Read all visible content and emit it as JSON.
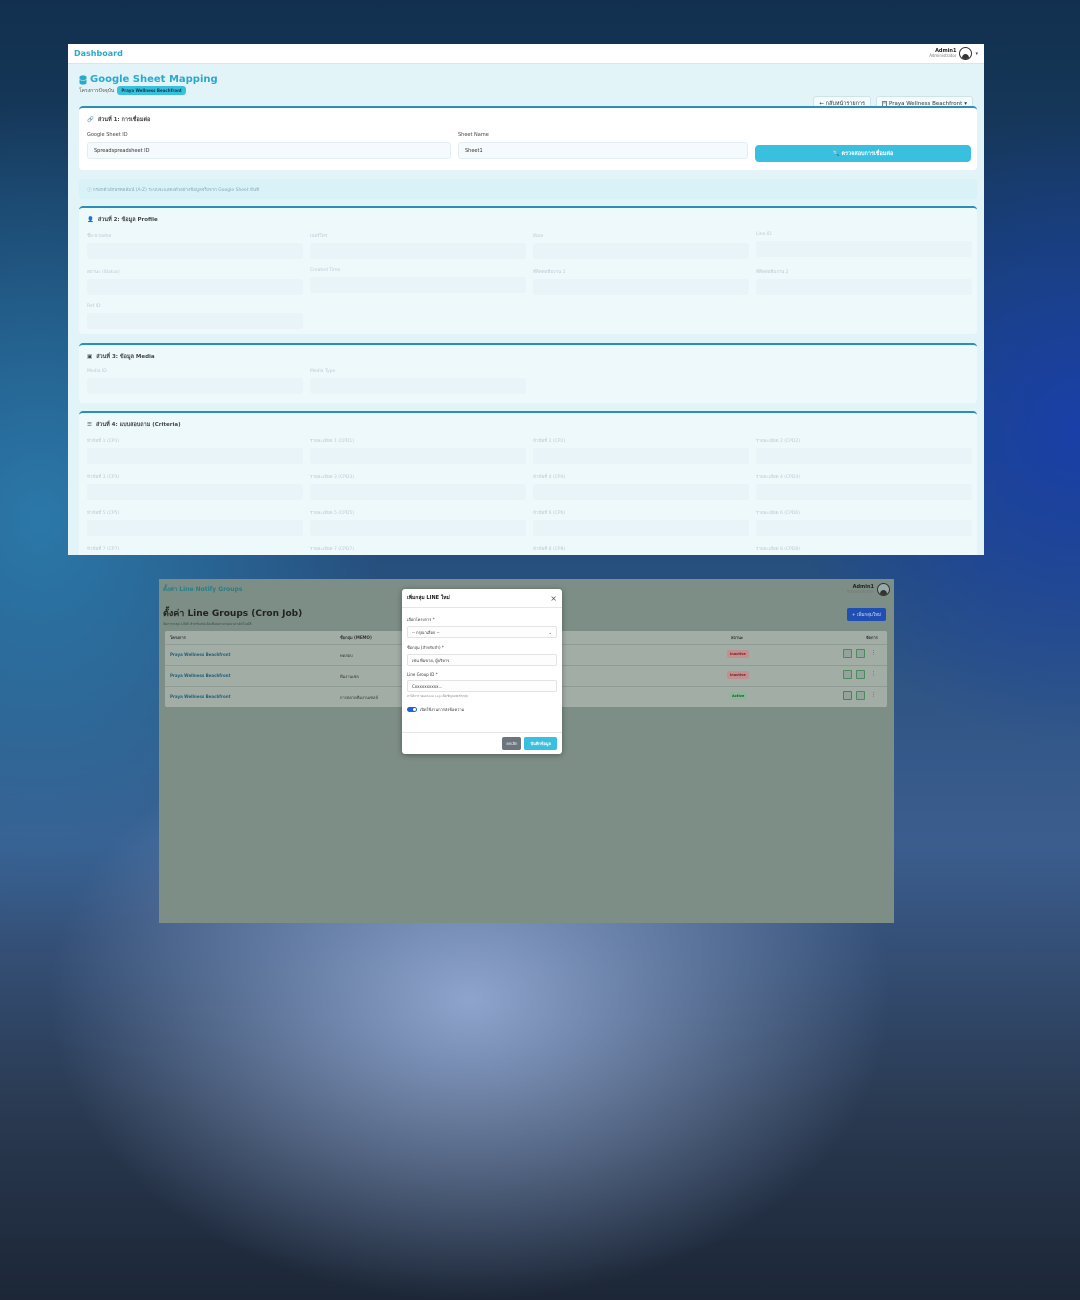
{
  "shot1": {
    "brand": "Dashboard",
    "user": {
      "name": "Admin1",
      "role": "Administrator"
    },
    "page_title": "Google Sheet Mapping",
    "project_label": "โครงการปัจจุบัน",
    "project_pill": "Praya Wellness Beachfront",
    "back_button": "← กลับหน้ารายการ",
    "project_select": "Praya Wellness Beachfront",
    "section1": {
      "title": "ส่วนที่ 1: การเชื่อมต่อ",
      "sheet_id_label": "Google Sheet ID",
      "sheet_id_value": "Spreadspreadsheet ID",
      "sheet_name_label": "Sheet Name",
      "sheet_name_value": "Sheet1",
      "check_button": "ตรวจสอบการเชื่อมต่อ"
    },
    "note": "ⓘ กรอกตัวอักษรคอลัมน์ (A-Z) ระบบจะแสดงตัวอย่างข้อมูลจริงจาก Google Sheet ทันที",
    "section2": {
      "title": "ส่วนที่ 2: ข้อมูล Profile",
      "fields": [
        "ชื่อ-นามสกุล",
        "เบอร์โทร",
        "อีเมล",
        "Line ID",
        "สถานะ (Status)",
        "Created Time",
        "ที่ติดต่อทีมงาน 1",
        "ที่ติดต่อทีมงาน 2",
        "Ref ID"
      ]
    },
    "section3": {
      "title": "ส่วนที่ 3: ข้อมูล Media",
      "fields": [
        "Media ID",
        "Media Type"
      ]
    },
    "section4": {
      "title": "ส่วนที่ 4: แบบสอบถาม (Criteria)",
      "fields": [
        "หัวข้อที่ 1 (CP1)",
        "รายละเอียด 1 (CPD1)",
        "หัวข้อที่ 2 (CP2)",
        "รายละเอียด 2 (CPD2)",
        "หัวข้อที่ 3 (CP3)",
        "รายละเอียด 3 (CPD3)",
        "หัวข้อที่ 4 (CP4)",
        "รายละเอียด 4 (CPD4)",
        "หัวข้อที่ 5 (CP5)",
        "รายละเอียด 5 (CPD5)",
        "หัวข้อที่ 6 (CP6)",
        "รายละเอียด 6 (CPD6)",
        "หัวข้อที่ 7 (CP7)",
        "รายละเอียด 7 (CPD7)",
        "หัวข้อที่ 8 (CP8)",
        "รายละเอียด 8 (CPD8)"
      ]
    }
  },
  "shot2": {
    "brand": "ตั้งค่า Line Notify Groups",
    "user": {
      "name": "Admin1",
      "role": "Administrator"
    },
    "page_title": "ตั้งค่า Line Groups (Cron Job)",
    "page_sub": "จัดการกลุ่ม LINE สำหรับส่งแจ้งเตือนตามรอบเวลาอัตโนมัติ",
    "add_button": "+ เพิ่มกลุ่มใหม่",
    "table_headers": {
      "project": "โครงการ",
      "group": "ชื่อกลุ่ม (MEMO)",
      "status": "สถานะ",
      "manage": "จัดการ"
    },
    "rows": [
      {
        "project": "Praya Wellness Beachfront",
        "group": "ทดสอบ",
        "status": "Inactive"
      },
      {
        "project": "Praya Wellness Beachfront",
        "group": "ทีมงานเซล",
        "status": "Inactive"
      },
      {
        "project": "Praya Wellness Beachfront",
        "group": "การตลาดทีมงานเซลล์",
        "status": "Active"
      }
    ],
    "modal": {
      "title": "เพิ่มกลุ่ม LINE ใหม่",
      "project_label": "เลือกโครงการ *",
      "project_value": "-- กรุณาเลือก --",
      "name_label": "ชื่อกลุ่ม (สำหรับจำ) *",
      "name_value": "เช่น ทีมขาย, ผู้บริหาร",
      "id_label": "Line Group ID *",
      "id_value": "Cxxxxxxxxxx...",
      "id_help": "หาได้จาก Webhook Log เมื่อเชิญบอทเข้ากลุ่ม",
      "toggle_label": "เปิดใช้งานการส่งข้อความ",
      "cancel": "ยกเลิก",
      "save": "บันทึกข้อมูล"
    }
  }
}
